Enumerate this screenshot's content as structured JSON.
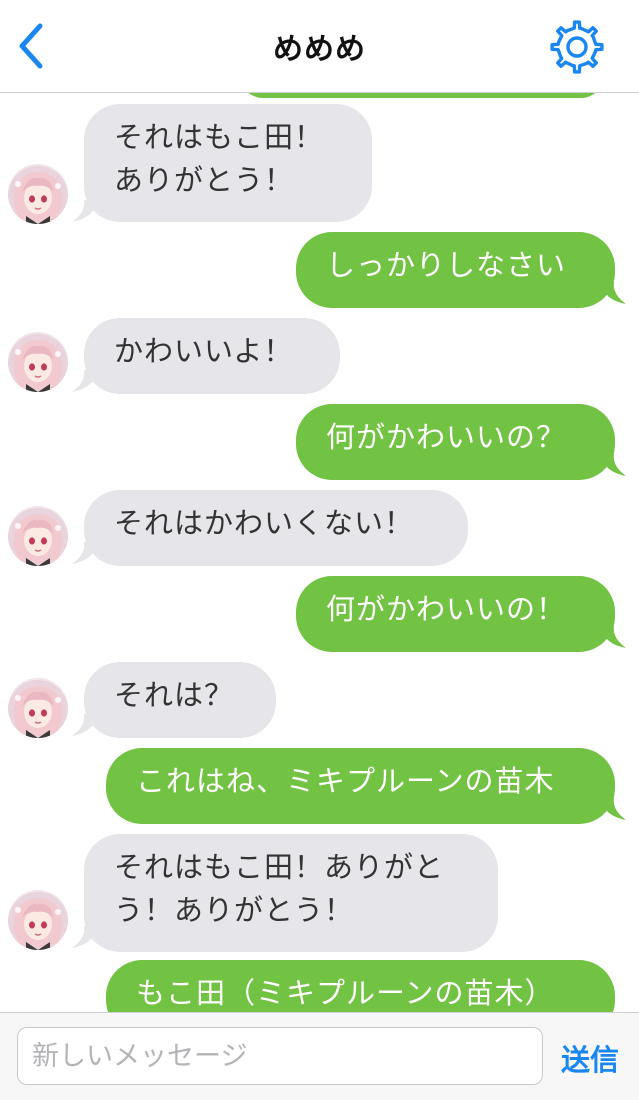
{
  "header": {
    "title": "めめめ",
    "back_icon": "chevron-left-icon",
    "settings_icon": "gear-icon",
    "accent_color": "#1a86f0"
  },
  "messages": [
    {
      "side": "in",
      "lines": [
        "それはもこ田！",
        "ありがとう！"
      ]
    },
    {
      "side": "out",
      "lines": [
        "しっかりしなさい"
      ]
    },
    {
      "side": "in",
      "lines": [
        "かわいいよ！"
      ]
    },
    {
      "side": "out",
      "lines": [
        "何がかわいいの？"
      ]
    },
    {
      "side": "in",
      "lines": [
        "それはかわいくない！"
      ]
    },
    {
      "side": "out",
      "lines": [
        "何がかわいいの！"
      ]
    },
    {
      "side": "in",
      "lines": [
        "それは？"
      ]
    },
    {
      "side": "out",
      "lines": [
        "これはね、ミキプルーンの苗木"
      ]
    },
    {
      "side": "in",
      "lines": [
        "それはもこ田！ありがと",
        "う！ありがとう！"
      ]
    },
    {
      "side": "out",
      "lines": [
        "もこ田（ミキプルーンの苗木）"
      ]
    }
  ],
  "colors": {
    "incoming_bubble": "#e5e5ea",
    "outgoing_bubble": "#72c243",
    "incoming_text": "#333333",
    "outgoing_text": "#ffffff"
  },
  "composer": {
    "placeholder": "新しいメッセージ",
    "value": "",
    "send_label": "送信"
  }
}
